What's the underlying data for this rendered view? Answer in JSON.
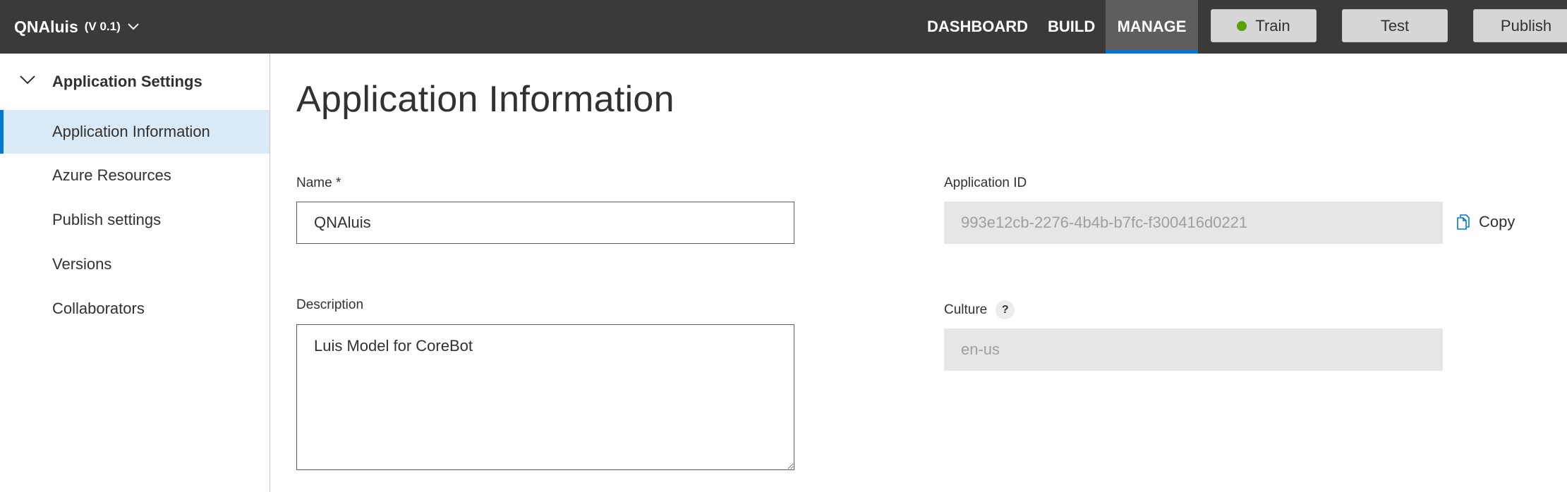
{
  "header": {
    "app_name": "QNAluis",
    "app_version": "(V 0.1)",
    "nav": {
      "dashboard": "DASHBOARD",
      "build": "BUILD",
      "manage": "MANAGE"
    },
    "buttons": {
      "train": "Train",
      "test": "Test",
      "publish": "Publish"
    }
  },
  "sidebar": {
    "group_label": "Application Settings",
    "items": [
      {
        "label": "Application Information",
        "selected": true
      },
      {
        "label": "Azure Resources",
        "selected": false
      },
      {
        "label": "Publish settings",
        "selected": false
      },
      {
        "label": "Versions",
        "selected": false
      },
      {
        "label": "Collaborators",
        "selected": false
      }
    ]
  },
  "main": {
    "title": "Application Information",
    "name_label": "Name *",
    "name_value": "QNAluis",
    "description_label": "Description",
    "description_value": "Luis Model for CoreBot",
    "app_id_label": "Application ID",
    "app_id_value": "993e12cb-2276-4b4b-b7fc-f300416d0221",
    "copy_label": "Copy",
    "culture_label": "Culture",
    "culture_help": "?",
    "culture_value": "en-us"
  },
  "icons": {
    "app_switcher": "chevron-down-icon",
    "group": "chevron-down-icon",
    "train_status": "status-dot-icon",
    "copy": "copy-icon",
    "help": "help-icon"
  },
  "colors": {
    "topbar": "#3b3a39",
    "accent": "#0078d4",
    "selected_bg": "#d9e9f6",
    "train_status": "#57a300"
  }
}
